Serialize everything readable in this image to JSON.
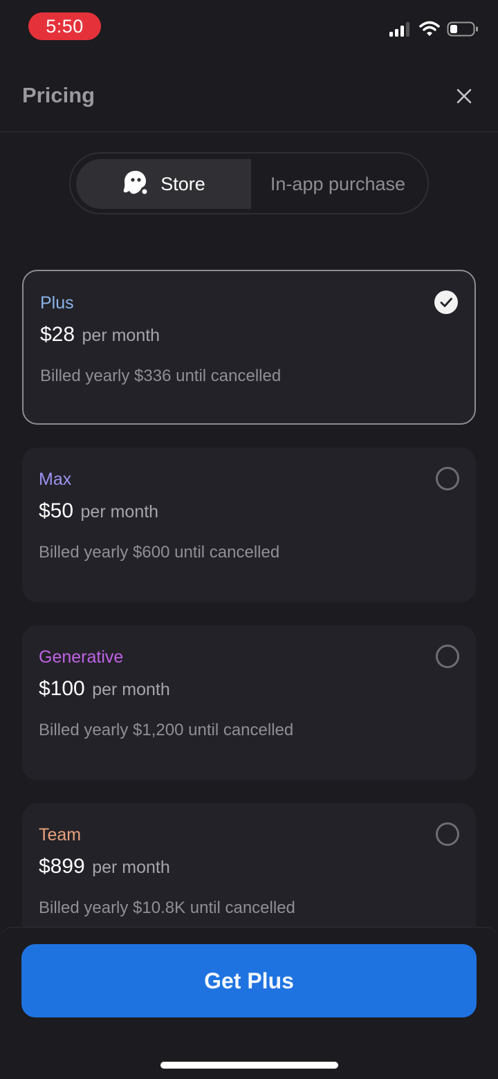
{
  "status_bar": {
    "time": "5:50",
    "time_pill_color": "#e5323a",
    "icons": [
      "signal-icon",
      "wifi-icon",
      "battery-icon"
    ]
  },
  "header": {
    "title": "Pricing",
    "close_icon": "close-icon"
  },
  "segmented": {
    "store_label": "Store",
    "store_icon": "ghost-icon",
    "inapp_label": "In-app purchase",
    "selected": "Store"
  },
  "plans": [
    {
      "name": "Plus",
      "name_color": "#8ab4ea",
      "price": "$28",
      "unit": "per month",
      "billing": "Billed yearly $336 until cancelled",
      "selected": true
    },
    {
      "name": "Max",
      "name_color": "#9b93f2",
      "price": "$50",
      "unit": "per month",
      "billing": "Billed yearly $600 until cancelled",
      "selected": false
    },
    {
      "name": "Generative",
      "name_color": "#c062e6",
      "price": "$100",
      "unit": "per month",
      "billing": "Billed yearly $1,200 until cancelled",
      "selected": false
    },
    {
      "name": "Team",
      "name_color": "#e9a27d",
      "price": "$899",
      "unit": "per month",
      "billing": "Billed yearly $10.8K until cancelled",
      "selected": false
    }
  ],
  "cta": {
    "label": "Get Plus",
    "color": "#1f73e0"
  }
}
